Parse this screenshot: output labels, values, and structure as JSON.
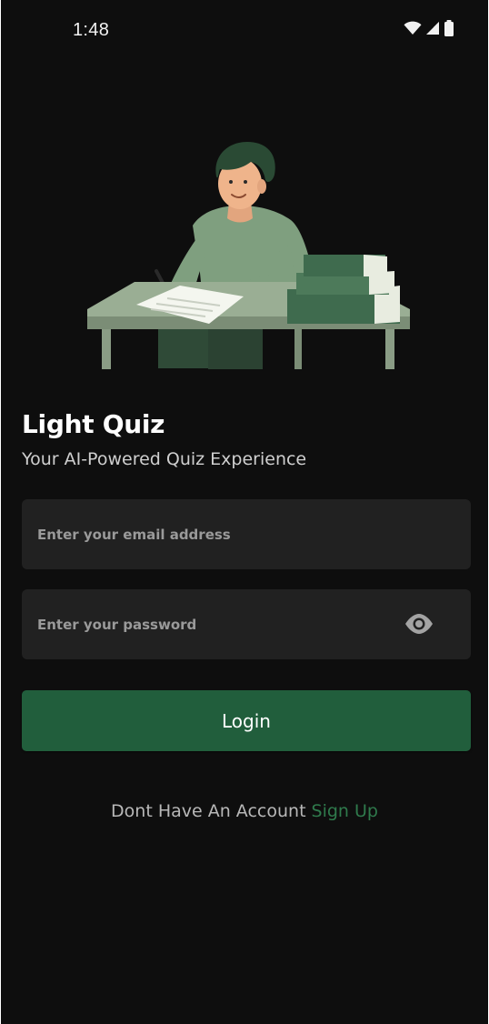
{
  "status_bar": {
    "time": "1:48",
    "icons": [
      "wifi-icon",
      "cellular-signal-icon",
      "battery-icon"
    ]
  },
  "illustration": {
    "icon": "student-writing-at-desk-illustration"
  },
  "header": {
    "title": "Light Quiz",
    "subtitle": "Your AI-Powered Quiz Experience"
  },
  "form": {
    "email": {
      "value": "",
      "placeholder": "Enter your email address"
    },
    "password": {
      "value": "",
      "placeholder": "Enter your password",
      "toggle_icon": "eye-icon"
    },
    "login_label": "Login"
  },
  "footer": {
    "prompt": "Dont Have An Account",
    "signup_label": "Sign Up"
  },
  "colors": {
    "background": "#0e0e0e",
    "field_background": "#212121",
    "primary_button": "#215e3c",
    "link": "#2f7a4c",
    "illustration_green": "#3f6b4e",
    "illustration_light": "#9aae94"
  }
}
